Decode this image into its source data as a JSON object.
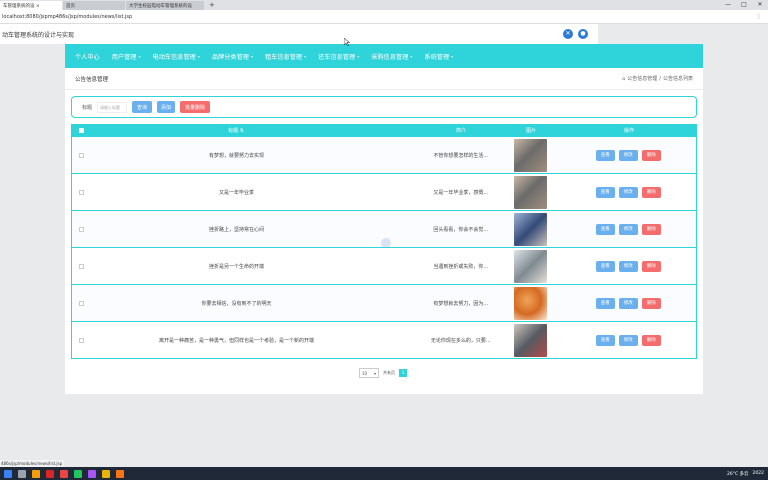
{
  "browser": {
    "tabs": [
      {
        "label": "车管理系统的设 ×",
        "active": true
      },
      {
        "label": "首页",
        "active": false
      },
      {
        "label": "大学生校园电动车管理系统的设",
        "active": false
      }
    ],
    "new_tab": "+",
    "window_controls": [
      "—",
      "□",
      "✕"
    ],
    "address": "localhost:8080/jspmp486s/jsp/modules/news/list.jsp",
    "status_url": "486s/jsp/modules/news/list.jsp"
  },
  "app": {
    "title": "动车管理系统的设计与实现"
  },
  "nav": {
    "items": [
      {
        "label": "个人中心"
      },
      {
        "label": "用户管理"
      },
      {
        "label": "电动车信息管理"
      },
      {
        "label": "品牌分类管理"
      },
      {
        "label": "租车信息管理"
      },
      {
        "label": "还车信息管理"
      },
      {
        "label": "采购信息管理"
      },
      {
        "label": "系统管理"
      }
    ]
  },
  "page": {
    "title": "公告信息管理",
    "breadcrumb": [
      "公告信息管理",
      "公告信息列表"
    ],
    "breadcrumb_sep": "/"
  },
  "search": {
    "label": "标题",
    "placeholder": "请输入标题",
    "query_button": "查询",
    "add_button": "添加",
    "batch_delete_button": "批量删除"
  },
  "table": {
    "headers": {
      "title": "标题 ⇅",
      "intro": "简介",
      "image": "图片",
      "ops": "操作"
    },
    "ops_labels": {
      "view": "查看",
      "edit": "修改",
      "delete": "删除"
    },
    "rows": [
      {
        "title": "有梦想，就要努力去实现",
        "intro": "不管你想要怎样的生活...",
        "img": "scooter-gray"
      },
      {
        "title": "又是一年毕业季",
        "intro": "又是一年毕业季，感慨...",
        "img": "scooter-gray"
      },
      {
        "title": "挫折路上，坚持常在心间",
        "intro": "回头看看，你会不会觉...",
        "img": "scooter-blue"
      },
      {
        "title": "挫折是另一个生命的开端",
        "intro": "当遇到挫折或失败，你...",
        "img": "scooter-white"
      },
      {
        "title": "你要去相信，没有到不了的明天",
        "intro": "有梦想就去努力，因为...",
        "img": "bread"
      },
      {
        "title": "离开是一种痛苦，是一种勇气，但同样也是一个考验，是一个新的开端",
        "intro": "无论你现在多么的，只要...",
        "img": "scooter-red"
      }
    ]
  },
  "pager": {
    "page_size": "10",
    "total_text": "共有页",
    "current_page": "1"
  },
  "taskbar": {
    "weather": "26°C 多云",
    "clock": "2022"
  },
  "colors": {
    "accent": "#2fd3da",
    "primary_btn": "#6ab0ee",
    "danger_btn": "#f56c6c"
  }
}
